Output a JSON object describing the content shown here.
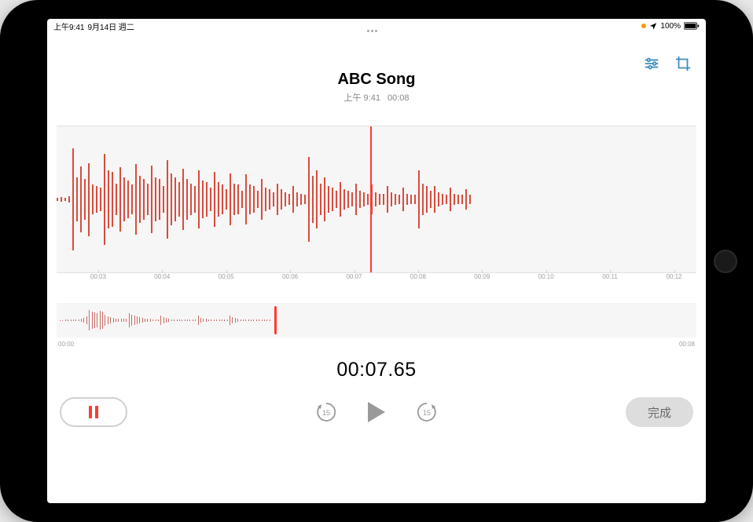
{
  "status_bar": {
    "time": "上午9:41",
    "date": "9月14日 週二",
    "battery_pct": "100%",
    "loc_icon": "location-icon"
  },
  "header": {
    "title": "ABC Song",
    "recorded_at": "上午 9:41",
    "duration": "00:08"
  },
  "timeline": {
    "ticks": [
      "00:03",
      "00:04",
      "00:05",
      "00:06",
      "00:07",
      "00:08",
      "00:09",
      "00:10",
      "00:11",
      "00:12"
    ],
    "tick_positions_pct": [
      6.5,
      16.5,
      26.5,
      36.5,
      46.5,
      56.5,
      66.5,
      76.5,
      86.5,
      96.5
    ]
  },
  "mini_timeline": {
    "start": "00:00",
    "end": "00:08"
  },
  "timer": "00:07.65",
  "controls": {
    "skip_seconds": "15",
    "done_label": "完成"
  },
  "colors": {
    "accent_red": "#ff3b30",
    "wave_red": "#d84c3e",
    "icon_blue": "#3e8fbc"
  },
  "waveform_main_heights_pct": [
    2,
    3,
    2,
    4,
    70,
    30,
    45,
    28,
    50,
    20,
    18,
    16,
    62,
    40,
    38,
    22,
    44,
    30,
    26,
    20,
    48,
    32,
    28,
    22,
    46,
    30,
    28,
    18,
    54,
    36,
    30,
    24,
    42,
    28,
    22,
    18,
    40,
    26,
    24,
    16,
    38,
    24,
    20,
    14,
    36,
    22,
    20,
    12,
    34,
    20,
    18,
    12,
    28,
    16,
    14,
    10,
    22,
    14,
    10,
    8,
    18,
    10,
    8,
    6,
    58,
    32,
    40,
    22,
    30,
    18,
    16,
    12,
    24,
    14,
    12,
    10,
    22,
    12,
    10,
    8,
    20,
    10,
    8,
    8,
    18,
    10,
    8,
    6,
    16,
    8,
    6,
    6,
    40,
    22,
    18,
    12,
    18,
    10,
    8,
    6,
    16,
    8,
    6,
    6,
    14,
    6
  ],
  "waveform_mini_heights_pct": [
    2,
    2,
    3,
    3,
    4,
    4,
    4,
    6,
    8,
    12,
    24,
    60,
    50,
    44,
    40,
    55,
    48,
    30,
    22,
    18,
    14,
    10,
    9,
    8,
    7,
    7,
    40,
    30,
    28,
    22,
    16,
    12,
    10,
    8,
    7,
    6,
    5,
    5,
    28,
    18,
    12,
    8,
    6,
    5,
    5,
    4,
    4,
    4,
    4,
    4,
    4,
    4,
    26,
    14,
    10,
    8,
    6,
    5,
    4,
    4,
    4,
    3,
    3,
    3,
    28,
    18,
    12,
    8,
    5,
    4,
    4,
    3,
    3,
    3,
    3,
    3,
    3,
    3,
    3,
    3
  ]
}
